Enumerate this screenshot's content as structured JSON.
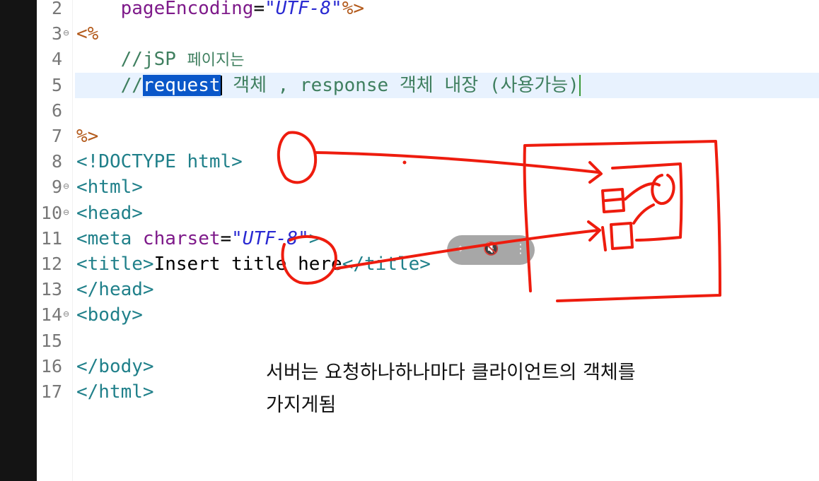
{
  "editor": {
    "lines": [
      {
        "num": "2",
        "parts": [
          {
            "t": "    pageEncoding",
            "c": "attr"
          },
          {
            "t": "=",
            "c": ""
          },
          {
            "t": "\"UTF-8\"",
            "c": "str"
          },
          {
            "t": "%>",
            "c": "jsp"
          }
        ]
      },
      {
        "num": "3",
        "fold": true,
        "parts": [
          {
            "t": "<%",
            "c": "jsp"
          }
        ]
      },
      {
        "num": "4",
        "parts": [
          {
            "t": "    //jSP ",
            "c": "comment"
          },
          {
            "t": "페이지는",
            "c": "comment kor"
          }
        ]
      },
      {
        "num": "5",
        "current": true,
        "parts": [
          {
            "t": "    //",
            "c": "comment"
          },
          {
            "t": "request",
            "c": "comment sel"
          },
          {
            "t": "",
            "c": "caret"
          },
          {
            "t": " 객체 , response 객체 내장 (사용가능)",
            "c": "comment"
          },
          {
            "t": "",
            "c": "caret2"
          }
        ]
      },
      {
        "num": "6",
        "parts": []
      },
      {
        "num": "7",
        "parts": [
          {
            "t": "%>",
            "c": "jsp"
          }
        ]
      },
      {
        "num": "8",
        "parts": [
          {
            "t": "<!DOCTYPE html>",
            "c": "tag"
          }
        ]
      },
      {
        "num": "9",
        "fold": true,
        "parts": [
          {
            "t": "<html>",
            "c": "tag"
          }
        ]
      },
      {
        "num": "10",
        "fold": true,
        "parts": [
          {
            "t": "<head>",
            "c": "tag"
          }
        ]
      },
      {
        "num": "11",
        "parts": [
          {
            "t": "<meta ",
            "c": "tag"
          },
          {
            "t": "charset",
            "c": "attr"
          },
          {
            "t": "=",
            "c": ""
          },
          {
            "t": "\"UTF-8\"",
            "c": "str"
          },
          {
            "t": ">",
            "c": "tag"
          }
        ]
      },
      {
        "num": "12",
        "parts": [
          {
            "t": "<title>",
            "c": "tag"
          },
          {
            "t": "Insert title here",
            "c": ""
          },
          {
            "t": "</title>",
            "c": "tag"
          }
        ]
      },
      {
        "num": "13",
        "parts": [
          {
            "t": "</head>",
            "c": "tag"
          }
        ]
      },
      {
        "num": "14",
        "fold": true,
        "parts": [
          {
            "t": "<body>",
            "c": "tag"
          }
        ]
      },
      {
        "num": "15",
        "parts": []
      },
      {
        "num": "16",
        "parts": [
          {
            "t": "</body>",
            "c": "tag"
          }
        ]
      },
      {
        "num": "17",
        "parts": [
          {
            "t": "</html>",
            "c": "tag"
          }
        ]
      }
    ]
  },
  "video_controls": {
    "icons": [
      "pin-off-icon",
      "volume-muted-icon",
      "more-vertical-icon"
    ],
    "glyphs": [
      "⌖",
      "🔇",
      "⋮"
    ]
  },
  "caption": {
    "line1": "서버는 요청하나하나마다 클라이언트의 객체를",
    "line2": "가지게됨"
  },
  "colors": {
    "annotation_ink": "#ee1c0e",
    "selection": "#0a57c9",
    "current_line": "#e8f2fe"
  }
}
